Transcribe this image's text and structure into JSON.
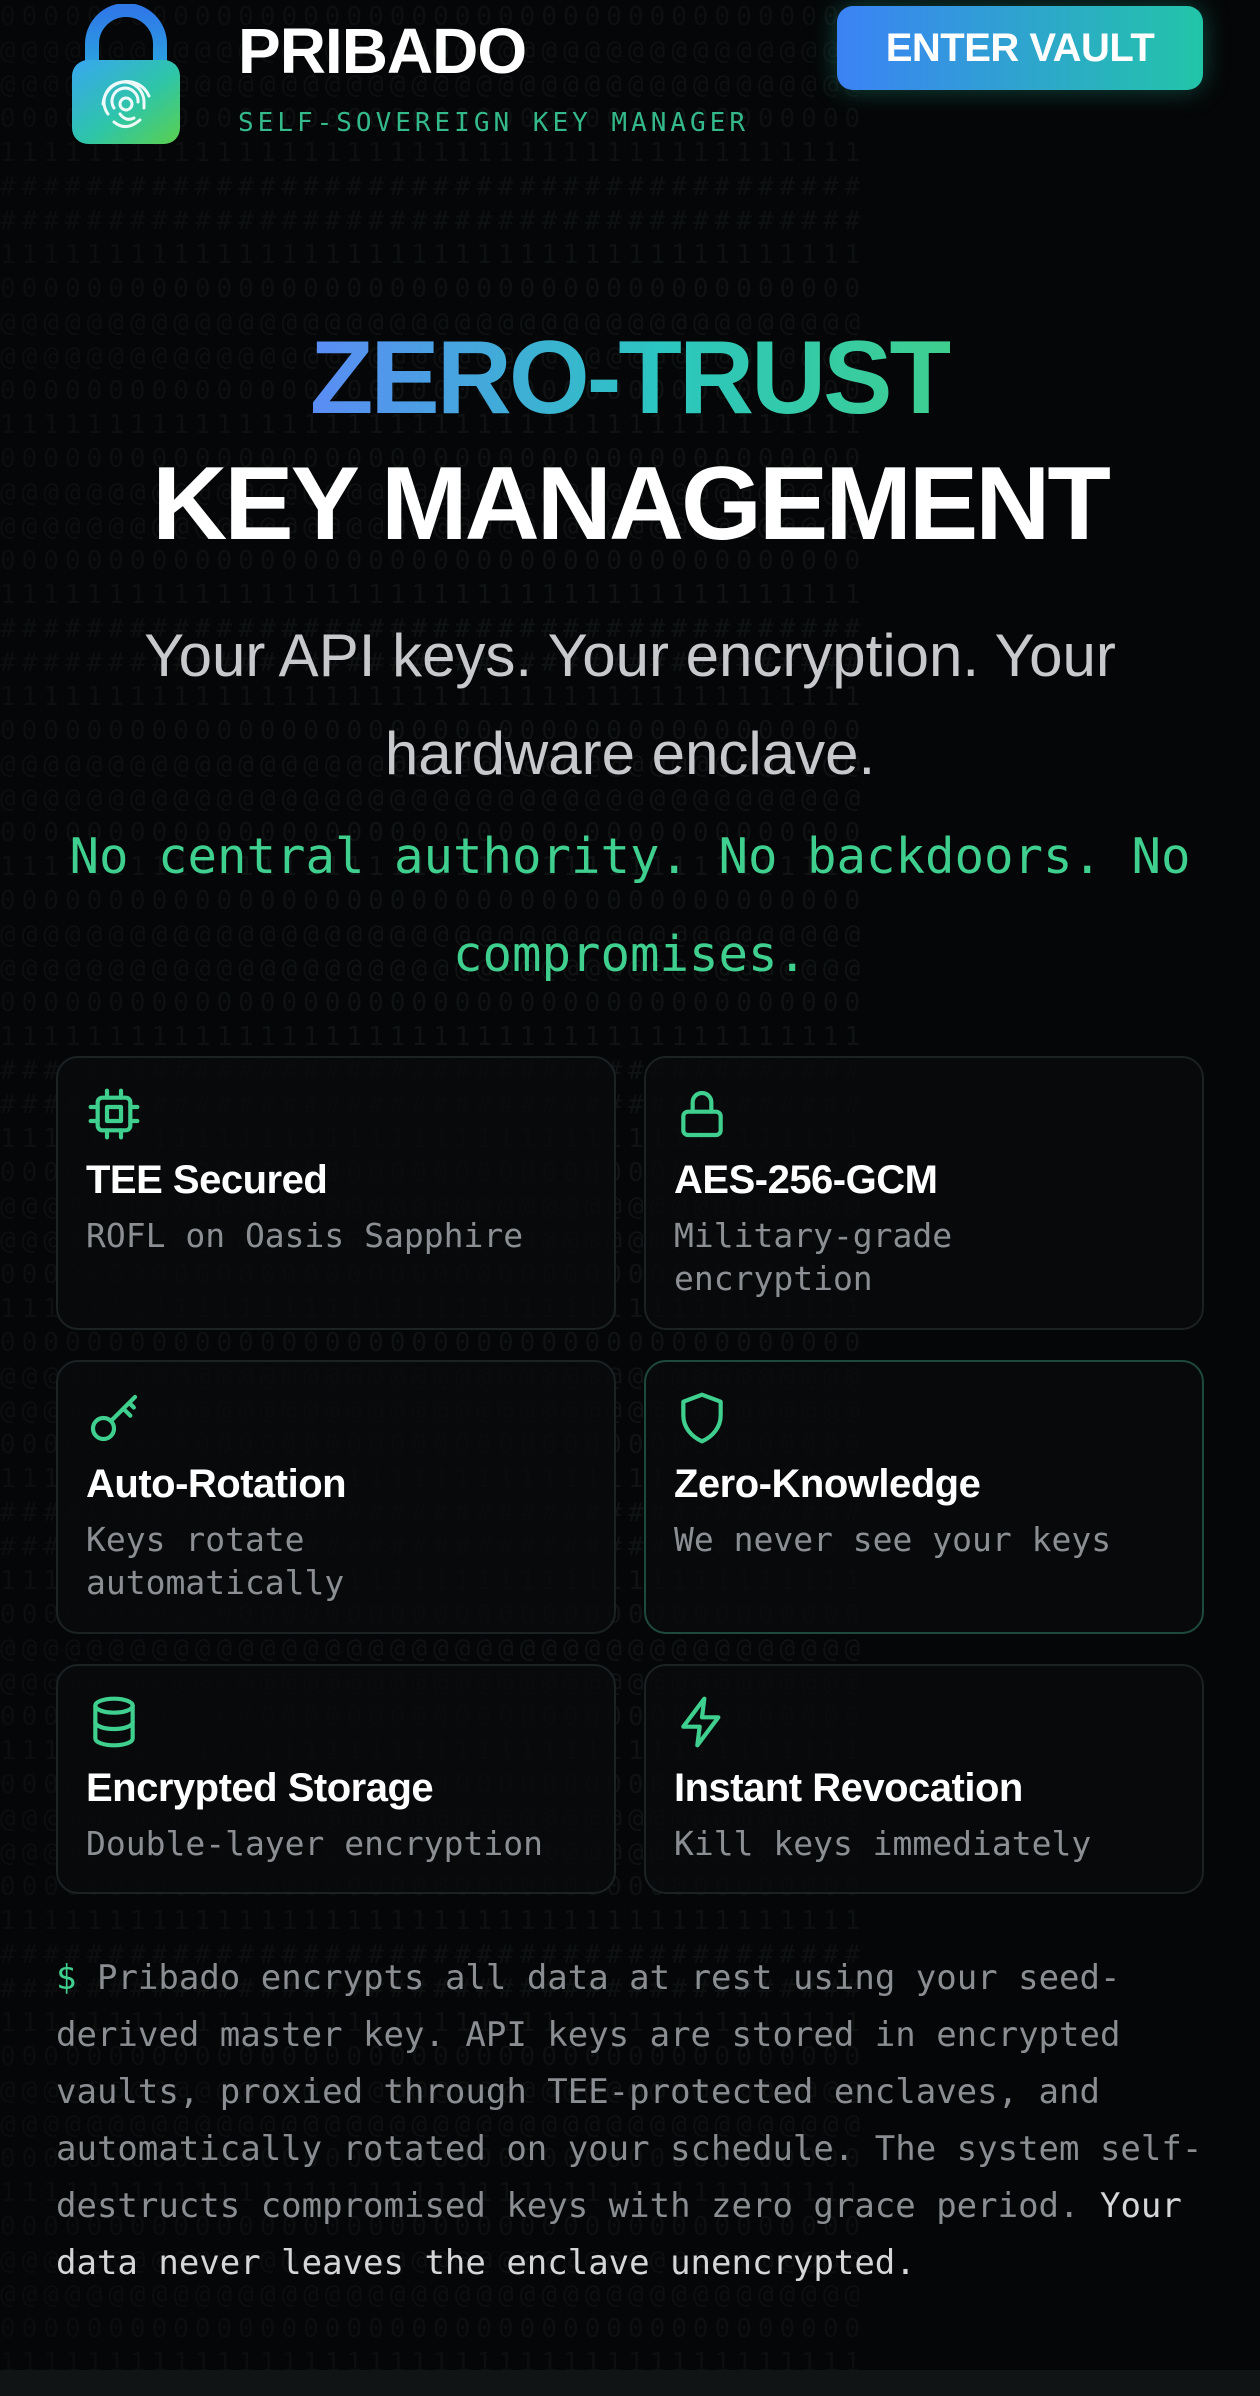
{
  "header": {
    "brand_name": "PRIBADO",
    "brand_tagline": "SELF-SOVEREIGN KEY MANAGER",
    "enter_button": "ENTER VAULT",
    "logo_icon": "padlock-fingerprint-icon"
  },
  "hero": {
    "line1": "ZERO-TRUST",
    "line2": "KEY MANAGEMENT",
    "subtitle": "Your API keys. Your encryption. Your hardware enclave.",
    "mono_line": "No central authority. No backdoors. No compromises."
  },
  "features": [
    {
      "icon": "chip-icon",
      "title": "TEE Secured",
      "desc": "ROFL on Oasis Sapphire"
    },
    {
      "icon": "lock-icon",
      "title": "AES-256-GCM",
      "desc": "Military-grade encryption"
    },
    {
      "icon": "key-icon",
      "title": "Auto-Rotation",
      "desc": "Keys rotate automatically"
    },
    {
      "icon": "shield-icon",
      "title": "Zero-Knowledge",
      "desc": "We never see your keys"
    },
    {
      "icon": "database-icon",
      "title": "Encrypted Storage",
      "desc": "Double-layer encryption"
    },
    {
      "icon": "lightning-icon",
      "title": "Instant Revocation",
      "desc": "Kill keys immediately"
    }
  ],
  "terminal": {
    "prompt": "$",
    "body": "Pribado encrypts all data at rest using your seed-derived master key. API keys are stored in encrypted vaults, proxied through TEE-protected enclaves, and automatically rotated on your schedule. The system self-destructs compromised keys with zero grace period.",
    "emphasis": "Your data never leaves the enclave unencrypted."
  },
  "colors": {
    "accent_green": "#3fcf8e",
    "accent_blue": "#3b82f6",
    "background": "#050607"
  }
}
